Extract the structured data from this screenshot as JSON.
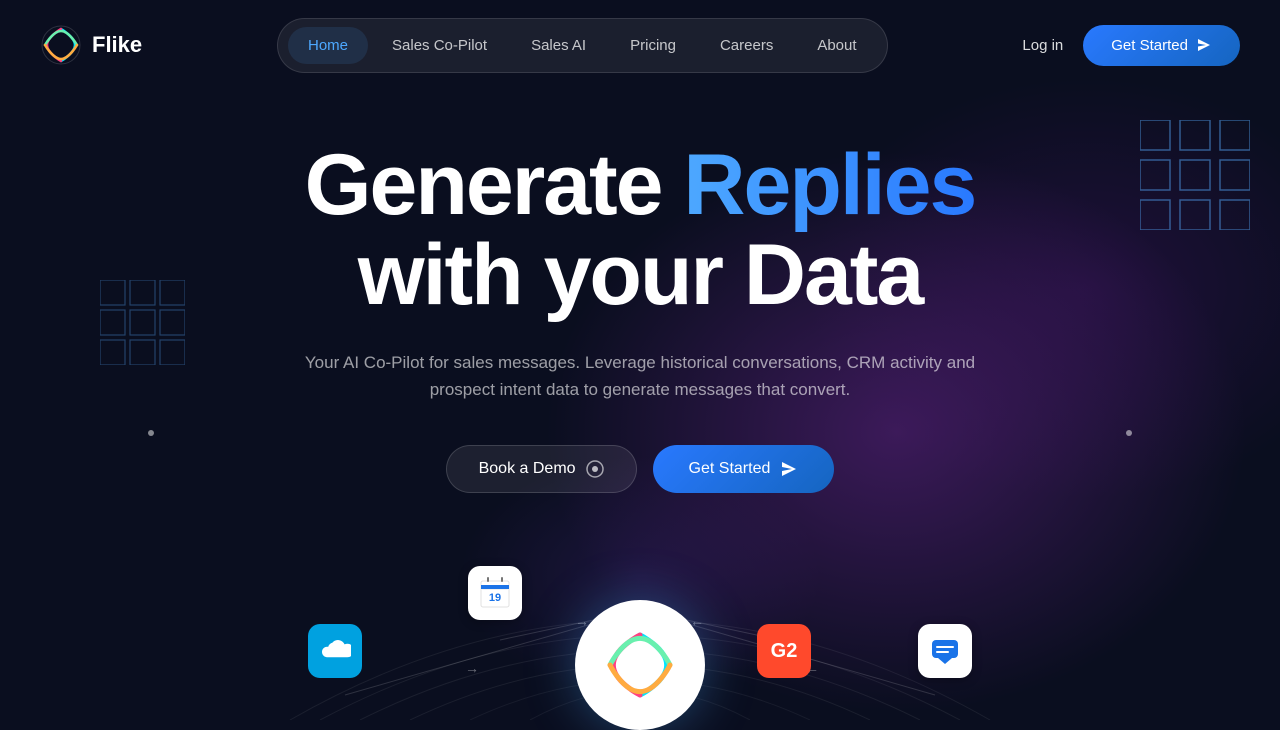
{
  "brand": {
    "name": "Flike",
    "logo_alt": "Flike logo"
  },
  "nav": {
    "links": [
      {
        "label": "Home",
        "active": true,
        "id": "home"
      },
      {
        "label": "Sales Co-Pilot",
        "active": false,
        "id": "sales-copilot"
      },
      {
        "label": "Sales AI",
        "active": false,
        "id": "sales-ai"
      },
      {
        "label": "Pricing",
        "active": false,
        "id": "pricing"
      },
      {
        "label": "Careers",
        "active": false,
        "id": "careers"
      },
      {
        "label": "About",
        "active": false,
        "id": "about"
      }
    ],
    "login_label": "Log in",
    "cta_label": "Get Started"
  },
  "hero": {
    "headline_part1": "Generate ",
    "headline_highlight": "Replies",
    "headline_part2": "with your Data",
    "subtext": "Your AI Co-Pilot for sales messages. Leverage historical conversations, CRM activity and prospect intent data to generate messages that convert.",
    "btn_demo": "Book a Demo",
    "btn_cta": "Get Started"
  },
  "integrations": [
    {
      "id": "salesforce",
      "label": "Salesforce"
    },
    {
      "id": "google-calendar",
      "label": "Google Calendar"
    },
    {
      "id": "g2",
      "label": "G2"
    },
    {
      "id": "messaging",
      "label": "Messaging"
    }
  ],
  "colors": {
    "accent_blue": "#4da8ff",
    "cta_blue": "#2979ff",
    "dark_bg": "#0a0e1f"
  }
}
